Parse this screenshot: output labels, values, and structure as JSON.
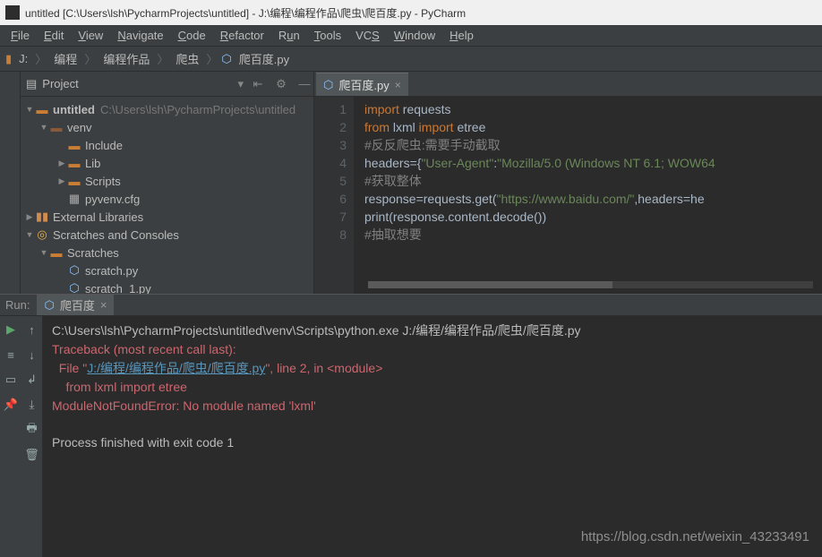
{
  "title": "untitled [C:\\Users\\lsh\\PycharmProjects\\untitled] - J:\\编程\\编程作品\\爬虫\\爬百度.py - PyCharm",
  "menu": {
    "file": "File",
    "edit": "Edit",
    "view": "View",
    "navigate": "Navigate",
    "code": "Code",
    "refactor": "Refactor",
    "run": "Run",
    "tools": "Tools",
    "vcs": "VCS",
    "window": "Window",
    "help": "Help"
  },
  "breadcrumbs": {
    "root": "J:",
    "p1": "编程",
    "p2": "编程作品",
    "p3": "爬虫",
    "file": "爬百度.py"
  },
  "project": {
    "title": "Project",
    "root": {
      "name": "untitled",
      "path": "C:\\Users\\lsh\\PycharmProjects\\untitled"
    },
    "venv": "venv",
    "include": "Include",
    "lib": "Lib",
    "scripts": "Scripts",
    "pyvenv": "pyvenv.cfg",
    "external": "External Libraries",
    "scratches": "Scratches and Consoles",
    "scratchesInner": "Scratches",
    "scratch1": "scratch.py",
    "scratch2": "scratch_1.py"
  },
  "editor": {
    "tab": "爬百度.py",
    "lines": {
      "l1": {
        "kw": "import",
        "rest": " requests"
      },
      "l2": {
        "kw1": "from",
        "mid": " lxml ",
        "kw2": "import",
        "rest": " etree"
      },
      "l3": "#反反爬虫:需要手动截取",
      "l4": {
        "a": "headers={",
        "s1": "\"User-Agent\"",
        "b": ":",
        "s2": "\"Mozilla/5.0 (Windows NT 6.1; WOW64"
      },
      "l5": "#获取整体",
      "l6": {
        "a": "response=requests.get(",
        "s1": "\"https://www.baidu.com/\"",
        "b": ",headers=he"
      },
      "l7": "print(response.content.decode())",
      "l8": "#抽取想要"
    }
  },
  "run": {
    "label": "Run:",
    "tab": "爬百度",
    "out1": "C:\\Users\\lsh\\PycharmProjects\\untitled\\venv\\Scripts\\python.exe J:/编程/编程作品/爬虫/爬百度.py",
    "tb": "Traceback (most recent call last):",
    "file1a": "  File \"",
    "file1link": "J:/编程/编程作品/爬虫/爬百度.py",
    "file1b": "\", line 2, in <module>",
    "frm": "    from lxml import etree",
    "err": "ModuleNotFoundError: No module named 'lxml'",
    "exit": "Process finished with exit code 1"
  },
  "watermark": "https://blog.csdn.net/weixin_43233491"
}
